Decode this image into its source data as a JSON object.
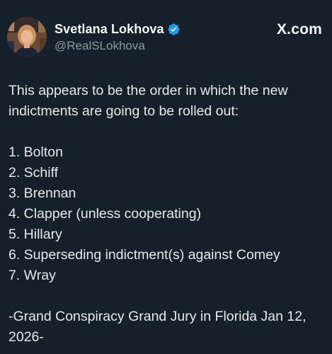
{
  "author": {
    "display_name": "Svetlana Lokhova",
    "handle": "@RealSLokhova",
    "verified_badge_icon": "verified-check-icon",
    "avatar_icon": "profile-photo"
  },
  "brand": {
    "label": "X.com"
  },
  "tweet": {
    "intro_line_1": "This appears to be the order in which the new",
    "intro_line_2": "indictments are going to be rolled out:",
    "items": [
      "1. Bolton",
      "2. Schiff",
      "3. Brennan",
      "4. Clapper (unless cooperating)",
      "5. Hillary",
      "6. Superseding indictment(s) against Comey",
      "7. Wray"
    ],
    "footer_line_1": "-Grand Conspiracy Grand Jury in Florida Jan 12,",
    "footer_line_2": "2026-"
  },
  "colors": {
    "background": "#15202b",
    "text": "#e7e9ea",
    "secondary_text": "#8b98a5",
    "verified_blue": "#1d9bf0"
  }
}
